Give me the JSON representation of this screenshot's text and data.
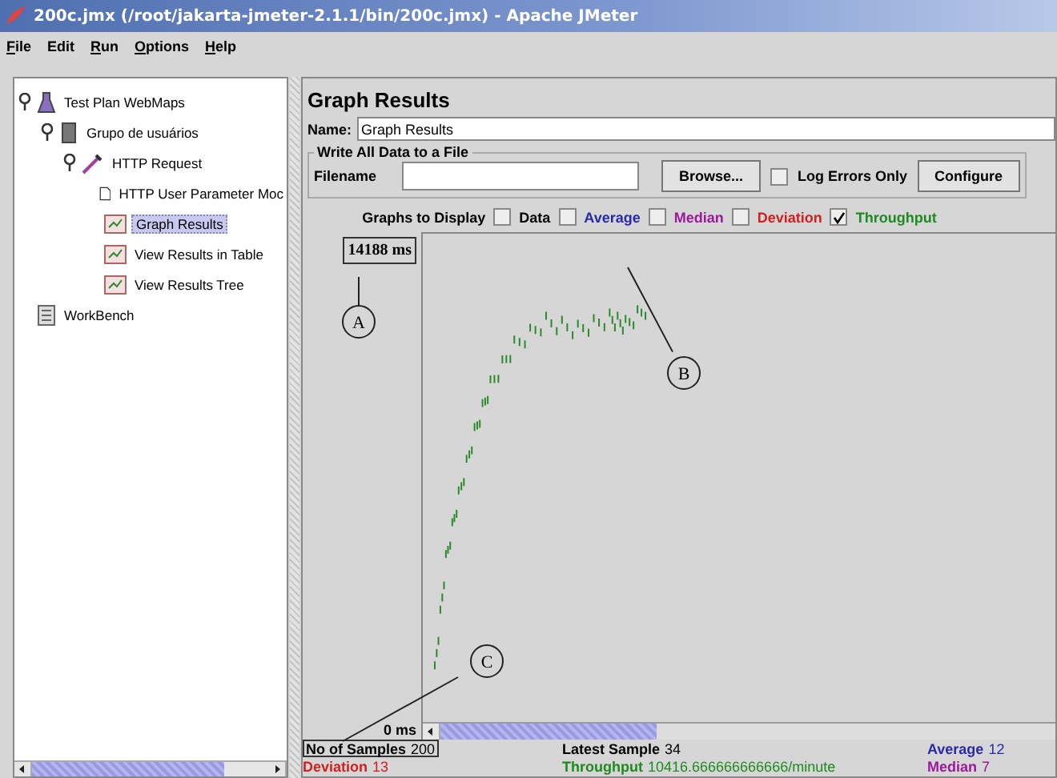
{
  "window": {
    "title": "200c.jmx (/root/jakarta-jmeter-2.1.1/bin/200c.jmx) - Apache JMeter"
  },
  "menu": [
    {
      "label": "File",
      "mnemonic": true
    },
    {
      "label": "Edit",
      "mnemonic": false
    },
    {
      "label": "Run",
      "mnemonic": true
    },
    {
      "label": "Options",
      "mnemonic": true
    },
    {
      "label": "Help",
      "mnemonic": true
    }
  ],
  "tree": [
    {
      "label": "Test Plan WebMaps",
      "kind": "plan",
      "selected": false,
      "expanded": true,
      "children": [
        {
          "label": "Grupo de usuários",
          "kind": "group",
          "selected": false,
          "expanded": true,
          "children": [
            {
              "label": "HTTP Request",
              "kind": "sampler",
              "selected": false,
              "expanded": true,
              "children": [
                {
                  "label": "HTTP User Parameter Moc",
                  "kind": "modifier",
                  "selected": false
                },
                {
                  "label": "Graph Results",
                  "kind": "listener",
                  "selected": true
                },
                {
                  "label": "View Results in Table",
                  "kind": "listener",
                  "selected": false
                },
                {
                  "label": "View Results Tree",
                  "kind": "listener",
                  "selected": false
                }
              ]
            }
          ]
        }
      ]
    },
    {
      "label": "WorkBench",
      "kind": "workbench",
      "selected": false
    }
  ],
  "panel": {
    "title": "Graph Results",
    "name_label": "Name:",
    "name_value": "Graph Results",
    "file_section": {
      "legend": "Write All Data to a File",
      "filename_label": "Filename",
      "browse": "Browse...",
      "log_errors": {
        "label": "Log Errors Only",
        "checked": false
      },
      "configure": "Configure"
    },
    "graphs_label": "Graphs to Display",
    "graphs": [
      {
        "label": "Data",
        "checked": false,
        "color": "#000000"
      },
      {
        "label": "Average",
        "checked": false,
        "color": "#2a2aa8"
      },
      {
        "label": "Median",
        "checked": false,
        "color": "#9a1a9a"
      },
      {
        "label": "Deviation",
        "checked": false,
        "color": "#d02020"
      },
      {
        "label": "Throughput",
        "checked": true,
        "color": "#1f8a1f"
      }
    ],
    "graph": {
      "max_label": "14188 ms",
      "min_label": "0 ms",
      "callouts": [
        "A",
        "B",
        "C"
      ]
    },
    "stats": [
      {
        "label": "No of Samples",
        "value": "200",
        "color": "#000000"
      },
      {
        "label": "Latest Sample",
        "value": "34",
        "color": "#000000"
      },
      {
        "label": "Average",
        "value": "12",
        "color": "#2a2aa8"
      },
      {
        "label": "Deviation",
        "value": "13",
        "color": "#d02020"
      },
      {
        "label": "Throughput",
        "value": "10416.666666666666/minute",
        "color": "#1f8a1f"
      },
      {
        "label": "Median",
        "value": "7",
        "color": "#9a1a9a"
      }
    ]
  }
}
